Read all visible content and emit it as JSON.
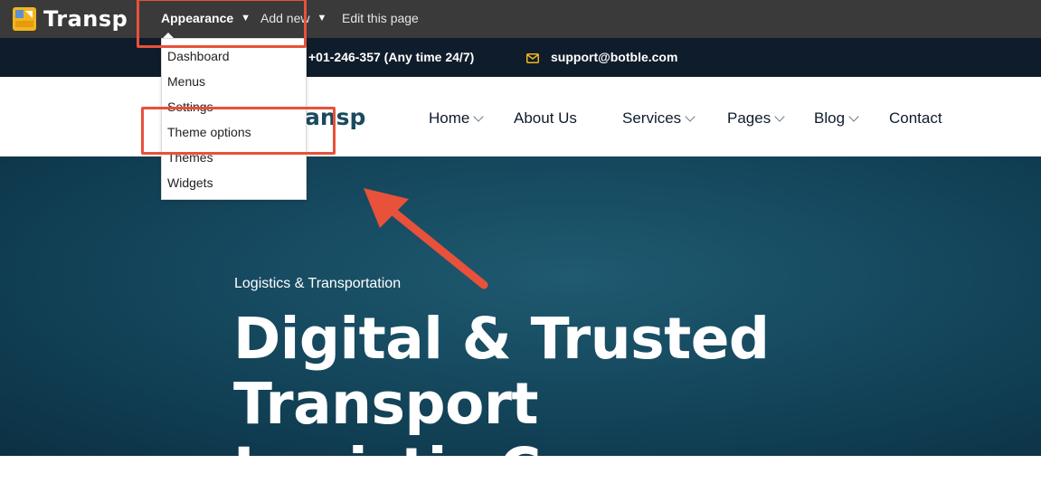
{
  "admin_bar": {
    "logo_text": "Transp",
    "items": [
      {
        "label": "Appearance"
      },
      {
        "label": "Add new"
      },
      {
        "label": "Edit this page"
      }
    ]
  },
  "appearance_menu": {
    "items": [
      {
        "label": "Dashboard"
      },
      {
        "label": "Menus"
      },
      {
        "label": "Settings"
      },
      {
        "label": "Theme options"
      },
      {
        "label": "Themes"
      },
      {
        "label": "Widgets"
      }
    ]
  },
  "top_bar": {
    "phone": "+01-246-357 (Any time 24/7)",
    "email": "support@botble.com"
  },
  "site_header": {
    "brand_partial": "ansp",
    "nav": [
      {
        "label": "Home"
      },
      {
        "label": "About Us"
      },
      {
        "label": "Services"
      },
      {
        "label": "Pages"
      },
      {
        "label": "Blog"
      },
      {
        "label": "Contact"
      }
    ]
  },
  "hero": {
    "subtitle": "Logistics & Transportation",
    "title_line1": "Digital & Trusted Transport",
    "title_line2": "Logistic Company"
  },
  "colors": {
    "admin_bar": "#3a3a3a",
    "top_bar": "#0f1c2b",
    "hero": "#174c62",
    "annotation": "#e8513a",
    "logo_accent": "#f2b61d"
  },
  "icons": [
    "logo-icon",
    "caret-down-icon",
    "mail-icon",
    "chevron-down-icon",
    "annotation-arrow-icon"
  ]
}
